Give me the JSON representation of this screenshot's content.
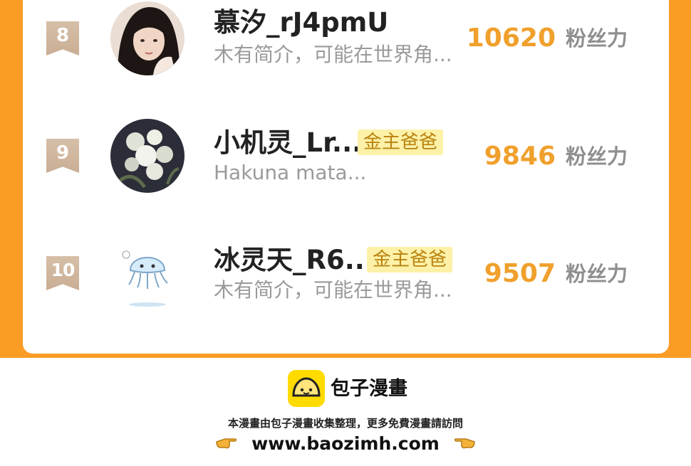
{
  "colors": {
    "accent": "#fb9c25",
    "score": "#f0a02c",
    "badge_bg": "#fdf1a8",
    "badge_text": "#b9820e",
    "logo": "#ffdb00"
  },
  "ranking": {
    "rows": [
      {
        "rank": "8",
        "name": "慕汐_rJ4pmU",
        "badge": "",
        "bio": "木有简介，可能在世界角...",
        "score": "10620",
        "unit": "粉丝力",
        "avatar": "girl-photo-avatar"
      },
      {
        "rank": "9",
        "name": "小机灵_Lr...",
        "badge": "金主爸爸",
        "bio": "Hakuna mata...",
        "score": "9846",
        "unit": "粉丝力",
        "avatar": "white-flowers-avatar"
      },
      {
        "rank": "10",
        "name": "冰灵天_R6...",
        "badge": "金主爸爸",
        "bio": "木有简介，可能在世界角...",
        "score": "9507",
        "unit": "粉丝力",
        "avatar": "jellyfish-cartoon-avatar"
      }
    ]
  },
  "footer": {
    "brand": "包子漫畫",
    "note": "本漫畫由包子漫畫收集整理，更多免費漫畫請訪問",
    "url": "www.baozimh.com",
    "icons": [
      "baozi-logo-icon",
      "pointing-hand-icon"
    ]
  }
}
